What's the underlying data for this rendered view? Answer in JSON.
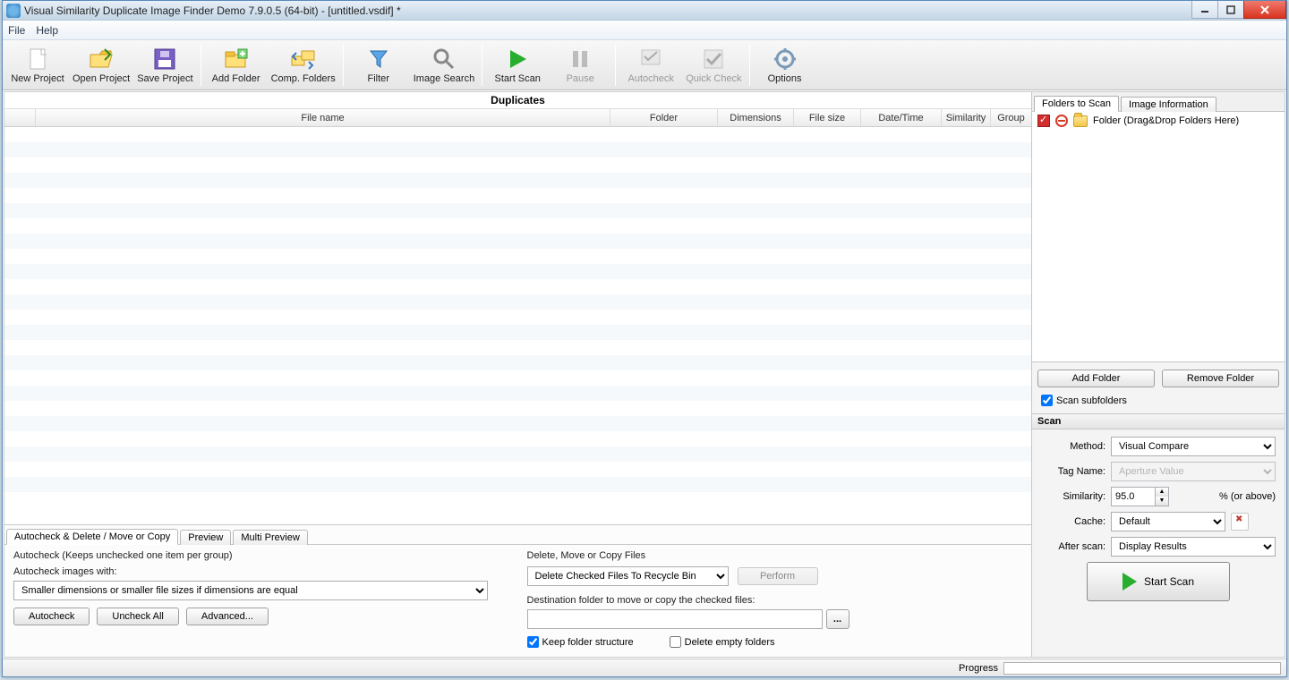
{
  "window": {
    "title": "Visual Similarity Duplicate Image Finder Demo 7.9.0.5 (64-bit) - [untitled.vsdif] *"
  },
  "menu": {
    "file": "File",
    "help": "Help"
  },
  "toolbar": {
    "new_project": "New Project",
    "open_project": "Open Project",
    "save_project": "Save Project",
    "add_folder": "Add Folder",
    "comp_folders": "Comp. Folders",
    "filter": "Filter",
    "image_search": "Image Search",
    "start_scan": "Start Scan",
    "pause": "Pause",
    "autocheck": "Autocheck",
    "quick_check": "Quick Check",
    "options": "Options"
  },
  "grid": {
    "title": "Duplicates",
    "headers": {
      "filename": "File name",
      "folder": "Folder",
      "dimensions": "Dimensions",
      "filesize": "File size",
      "datetime": "Date/Time",
      "similarity": "Similarity",
      "group": "Group"
    }
  },
  "bottom": {
    "tabs": {
      "autocheck": "Autocheck & Delete / Move or Copy",
      "preview": "Preview",
      "multi_preview": "Multi Preview"
    },
    "autocheck_panel": {
      "title": "Autocheck (Keeps unchecked one item per group)",
      "label": "Autocheck images with:",
      "select_value": "Smaller dimensions or smaller file sizes if dimensions are equal",
      "btn_autocheck": "Autocheck",
      "btn_uncheck": "Uncheck All",
      "btn_advanced": "Advanced..."
    },
    "delete_panel": {
      "title": "Delete, Move or Copy Files",
      "action_value": "Delete Checked Files To Recycle Bin",
      "perform": "Perform",
      "dest_label": "Destination folder to move or copy the checked files:",
      "browse": "...",
      "keep_structure": "Keep folder structure",
      "delete_empty": "Delete empty folders"
    }
  },
  "right": {
    "tabs": {
      "folders": "Folders to Scan",
      "image_info": "Image Information"
    },
    "folder_placeholder": "Folder (Drag&Drop Folders Here)",
    "add_folder": "Add Folder",
    "remove_folder": "Remove Folder",
    "scan_subfolders": "Scan subfolders",
    "scan_header": "Scan",
    "method_label": "Method:",
    "method_value": "Visual Compare",
    "tagname_label": "Tag Name:",
    "tagname_value": "Aperture Value",
    "similarity_label": "Similarity:",
    "similarity_value": "95.0",
    "similarity_suffix": "% (or above)",
    "cache_label": "Cache:",
    "cache_value": "Default",
    "afterscan_label": "After scan:",
    "afterscan_value": "Display Results",
    "start_scan": "Start Scan"
  },
  "statusbar": {
    "progress": "Progress"
  }
}
